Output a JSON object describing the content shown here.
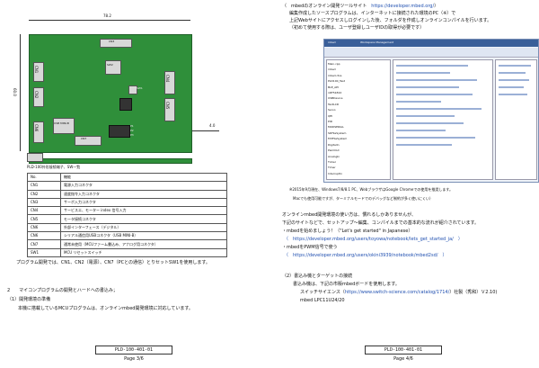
{
  "left": {
    "dimension_top": "78.2",
    "dimension_side": "60.0",
    "dimension_small": "4.0",
    "board_labels": {
      "cn1": "CN1",
      "cn2": "CN2",
      "cn3": "CN3",
      "cn4": "CN4",
      "cn5": "CN5",
      "cn6": "CN6",
      "cn7": "CN7",
      "sw1": "SW1",
      "sw2": "SW2",
      "usb": "USB MINI-B",
      "p1": "P1",
      "p2": "P2",
      "p3": "P3"
    },
    "table_caption": "PLD-100外形接続端子、SW一覧",
    "table_header": [
      "No.",
      "機能"
    ],
    "table_rows": [
      [
        "CN1",
        "電源入力コネクタ"
      ],
      [
        "CN2",
        "速度指令入力コネクタ"
      ],
      [
        "CN3",
        "サーボ入力コネクタ"
      ],
      [
        "CN4",
        "サービスエ、モーター index 信号入力"
      ],
      [
        "CN5",
        "モータ接続コネクタ"
      ],
      [
        "CN6",
        "外部インターフェース（デジタル）"
      ],
      [
        "CN6",
        "シリアル通信用USBコネクタ（USB MINI-B）"
      ],
      [
        "CN7",
        "通常未使用（MCUファーム書込み、アナログ用コネクタ）"
      ],
      [
        "SW1",
        "MCU リセットスイッチ"
      ]
    ],
    "note": "プログラム開発では、CN1、CN2（電源）、CN7（PCとの通信）とりセットSW1を使用します。",
    "section_heading": "2　　マイコンプログラムの開発とハードへの書込み；",
    "sub_heading": "（1）開発環境の準備",
    "sub_body": "本機に搭載しているMCUプログラムは、オンラインmbed開発環境に対応しています。",
    "footer_code": "PLD-100-401-01",
    "footer_page": "Page 3/6"
  },
  "right": {
    "l1": "（　mbedのオンライン開発ツールサイト　",
    "l1_link": "https://developer.mbed.org/",
    "l1_end": "）",
    "l2": "編集作成したソースプログラムは、インターネットに接続された環境のPC（※）で",
    "l3": "上記Webサイトにアクセスしログインした後、フォルダを作成しオンラインコンパイルを行います。",
    "l4": "（初めて使用する際は、ユーザ登録しユーザIDの取得が必要です）",
    "shot": {
      "title": "mbed",
      "tab": "Workspace Management",
      "files": [
        "Main.cpp",
        "mbed",
        "mbed-rtos",
        "PLD100_Test",
        "BLE_API",
        "nRF51822",
        "USBDevice",
        "TextLCD",
        "Servo",
        "QEI",
        "PID",
        "MODSERIAL",
        "SDFileSystem",
        "FATFileSystem",
        "DigitalIn",
        "PwmOut",
        "AnalogIn",
        "Ticker",
        "Timer",
        "InterruptIn"
      ]
    },
    "note1": "※2015年9月現在、Windows7/8/8.1 PC、WebブラウザはGoogle Chromeでの使用を推奨します。",
    "note2": "　Macでも使用可能ですが、ターミナルモードでのデバッグなど制約が多く使いにくい）",
    "p1": "オンラインmbed開発環境の使い方は、慣れるしかありませんが、",
    "p2": "下記のサイトなどで、セットアップ～編集、コンパイルまでの基本的な流れが紹介されています。",
    "p3": "・mbedを始めましょう！（\"Let's get started\" in Japanese）",
    "p3_link": "（　https://developer.mbed.org/users/toyowa/notebook/lets_get_started_ja/　）",
    "p4": "・mbedをPWM信号で使う",
    "p4_link": "（　https://developer.mbed.org/users/okini3939/notebook/mbed2sd/　）",
    "p5": "（2）書込み機とターゲットの接続",
    "p6": "書込み機は、下記の市販mbedボードを使用します。",
    "p7": "スイッチサイエンス（",
    "p7_link": "https://www.switch-science.com/catalog/1714/",
    "p7_end": "）社製（秀和）Ｖ2.10)",
    "p8": "mbed LPC11U24/20",
    "footer_code": "PLD-100-401-01",
    "footer_page": "Page 4/6"
  }
}
